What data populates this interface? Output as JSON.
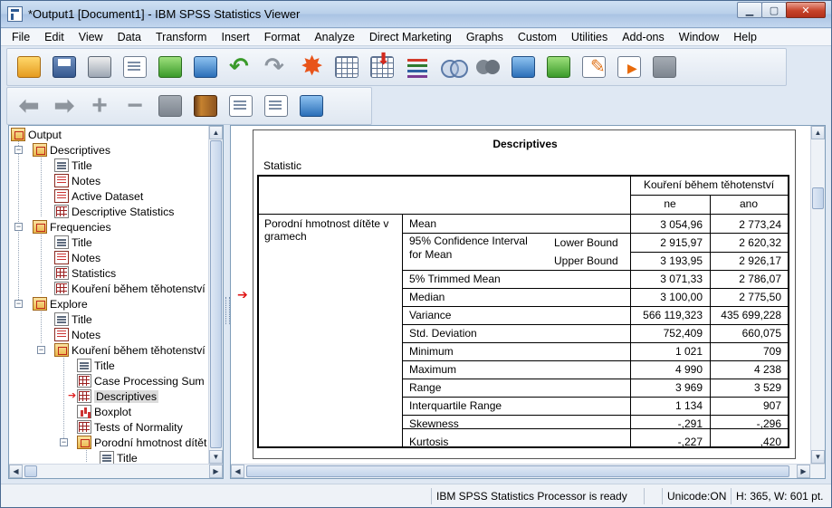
{
  "window": {
    "title": "*Output1 [Document1] - IBM SPSS Statistics Viewer",
    "minimize": "▁",
    "maximize": "▢",
    "close": "✕"
  },
  "menu": [
    "File",
    "Edit",
    "View",
    "Data",
    "Transform",
    "Insert",
    "Format",
    "Analyze",
    "Direct Marketing",
    "Graphs",
    "Custom",
    "Utilities",
    "Add-ons",
    "Window",
    "Help"
  ],
  "toolbar1_icons": [
    "open-icon",
    "save-icon",
    "print-icon",
    "print-preview-icon",
    "export-icon",
    "recall-dialog-icon",
    "undo-icon",
    "redo-icon",
    "go-to-data-icon",
    "go-to-case-icon",
    "insert-cases-icon",
    "variables-icon",
    "use-sets-icon",
    "show-all-variables-icon",
    "designate-window-icon",
    "syntax-icon",
    "edit-icon",
    "run-icon",
    "autoscript-icon"
  ],
  "toolbar2_icons": [
    "promote-icon",
    "demote-icon",
    "expand-icon",
    "collapse-icon",
    "show-icon",
    "hide-icon",
    "insert-heading-icon",
    "insert-title-icon",
    "insert-text-icon"
  ],
  "tree": {
    "root": "Output",
    "descriptives": "Descriptives",
    "desc_title": "Title",
    "desc_notes": "Notes",
    "desc_active": "Active Dataset",
    "desc_stats": "Descriptive Statistics",
    "frequencies": "Frequencies",
    "freq_title": "Title",
    "freq_notes": "Notes",
    "freq_stats": "Statistics",
    "freq_var": "Kouření během těhotenství",
    "explore": "Explore",
    "exp_title": "Title",
    "exp_notes": "Notes",
    "exp_var": "Kouření během těhotenství",
    "exp_var_title": "Title",
    "exp_case": "Case Processing Sum",
    "exp_desc": "Descriptives",
    "exp_boxplot": "Boxplot",
    "exp_normality": "Tests of Normality",
    "exp_por": "Porodní hmotnost dítět",
    "exp_por_title": "Title"
  },
  "output": {
    "title": "Descriptives",
    "subtitle": "Statistic",
    "col_group": "Kouření během těhotenství",
    "col_ne": "ne",
    "col_ano": "ano",
    "row_var_line1": "Porodní hmotnost dítěte v",
    "row_var_line2": "gramech",
    "ci_line1": "95% Confidence Interval",
    "ci_line2": "for Mean",
    "lower": "Lower Bound",
    "upper": "Upper Bound",
    "rows": [
      {
        "label": "Mean",
        "ne": "3 054,96",
        "ano": "2 773,24"
      },
      {
        "label": "",
        "ne": "2 915,97",
        "ano": "2 620,32"
      },
      {
        "label": "",
        "ne": "3 193,95",
        "ano": "2 926,17"
      },
      {
        "label": "5% Trimmed Mean",
        "ne": "3 071,33",
        "ano": "2 786,07"
      },
      {
        "label": "Median",
        "ne": "3 100,00",
        "ano": "2 775,50"
      },
      {
        "label": "Variance",
        "ne": "566 119,323",
        "ano": "435 699,228"
      },
      {
        "label": "Std. Deviation",
        "ne": "752,409",
        "ano": "660,075"
      },
      {
        "label": "Minimum",
        "ne": "1 021",
        "ano": "709"
      },
      {
        "label": "Maximum",
        "ne": "4 990",
        "ano": "4 238"
      },
      {
        "label": "Range",
        "ne": "3 969",
        "ano": "3 529"
      },
      {
        "label": "Interquartile Range",
        "ne": "1 134",
        "ano": "907"
      },
      {
        "label": "Skewness",
        "ne": "-,291",
        "ano": "-,296"
      },
      {
        "label": "Kurtosis",
        "ne": "-,227",
        "ano": ",420"
      }
    ]
  },
  "status": {
    "processor": "IBM SPSS Statistics Processor is ready",
    "unicode": "Unicode:ON",
    "dims": "H: 365, W: 601 pt."
  },
  "colors": {
    "selection_arrow": "#e02020",
    "pane_border": "#7f9db9"
  }
}
